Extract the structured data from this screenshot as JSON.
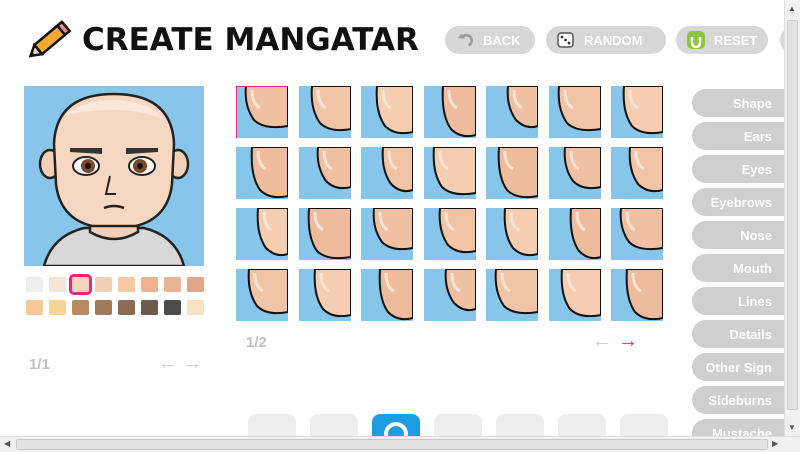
{
  "header": {
    "title": "CREATE MANGATAR",
    "buttons": {
      "back": "BACK",
      "random": "RANDOM",
      "reset": "RESET"
    }
  },
  "colors": {
    "accent_pink": "#e8267a",
    "sky_blue": "#87c6ea",
    "button_gray": "#d7d7d7",
    "reset_green": "#8cc63f",
    "tool_active_blue": "#1b9de0"
  },
  "skin_swatches": [
    {
      "color": "#eeeeee",
      "selected": false
    },
    {
      "color": "#f3e6d4",
      "selected": false
    },
    {
      "color": "#f7d5bd",
      "selected": true
    },
    {
      "color": "#f2cfb3",
      "selected": false
    },
    {
      "color": "#f7c9a3",
      "selected": false
    },
    {
      "color": "#eeb291",
      "selected": false
    },
    {
      "color": "#e9b293",
      "selected": false
    },
    {
      "color": "#dea888",
      "selected": false
    },
    {
      "color": "#f6c99a",
      "selected": false
    },
    {
      "color": "#f3d690",
      "selected": false
    },
    {
      "color": "#b98a62",
      "selected": false
    },
    {
      "color": "#9f7b5b",
      "selected": false
    },
    {
      "color": "#8c6a54",
      "selected": false
    },
    {
      "color": "#6d5a4f",
      "selected": false
    },
    {
      "color": "#4b4b4b",
      "selected": false
    },
    {
      "color": "#f7e2c3",
      "selected": false
    }
  ],
  "swatch_pager": {
    "page": "1/1"
  },
  "shape_pager": {
    "page": "1/2"
  },
  "categories": [
    "Shape",
    "Ears",
    "Eyes",
    "Eyebrows",
    "Nose",
    "Mouth",
    "Lines",
    "Details",
    "Other Sign",
    "Sideburns",
    "Mustache"
  ],
  "icons": {
    "logo": "pencil-icon",
    "back": "back-arrow-icon",
    "random": "dice-icon",
    "reset": "reset-icon",
    "prev": "arrow-left-icon",
    "next": "arrow-right-icon"
  },
  "bottom_tools": [
    {
      "name": "tool-1",
      "active": false
    },
    {
      "name": "tool-2",
      "active": false
    },
    {
      "name": "tool-face",
      "active": true
    },
    {
      "name": "tool-4",
      "active": false
    },
    {
      "name": "tool-5",
      "active": false
    },
    {
      "name": "tool-6",
      "active": false
    },
    {
      "name": "tool-7",
      "active": false
    }
  ]
}
